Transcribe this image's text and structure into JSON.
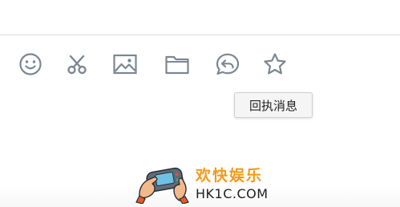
{
  "toolbar": {
    "icon_color": "#7b8794",
    "buttons": [
      {
        "icon": "emoji-icon"
      },
      {
        "icon": "scissors-icon"
      },
      {
        "icon": "image-icon"
      },
      {
        "icon": "folder-icon"
      },
      {
        "icon": "reply-icon"
      },
      {
        "icon": "star-icon"
      }
    ]
  },
  "tooltip": {
    "text": "回执消息"
  },
  "watermark": {
    "title": "欢快娱乐",
    "domain": "HK1C.COM",
    "title_color": "#f39a1b"
  }
}
